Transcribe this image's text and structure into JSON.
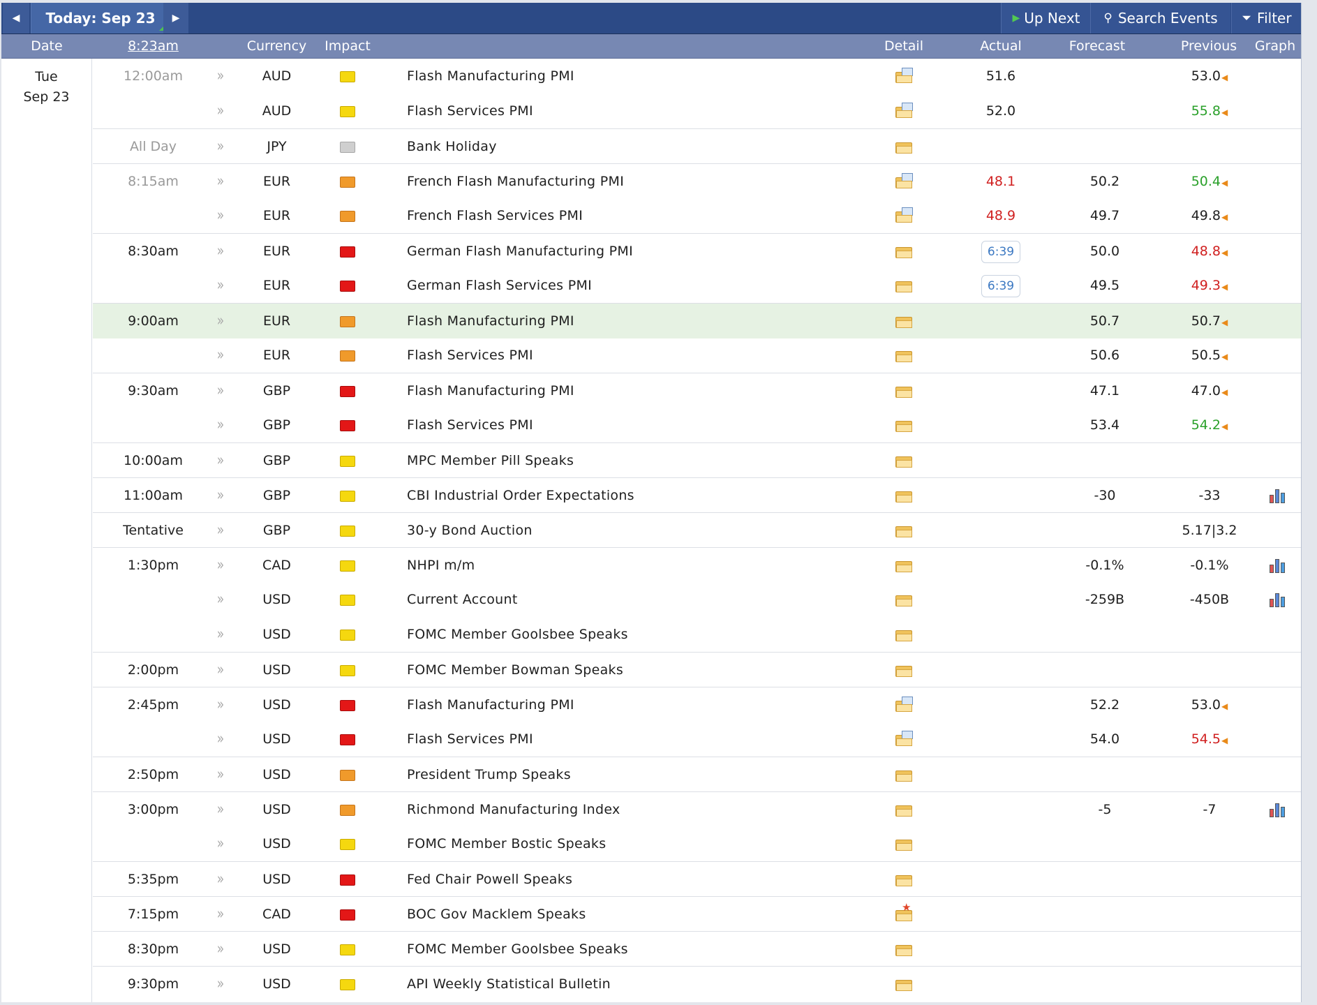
{
  "toolbar": {
    "prev_icon": "◀",
    "today_label": "Today: Sep 23",
    "next_icon": "▶",
    "up_next_label": "Up Next",
    "search_label": "Search Events",
    "filter_label": "Filter"
  },
  "headers": {
    "date": "Date",
    "time": "8:23am",
    "currency": "Currency",
    "impact": "Impact",
    "detail": "Detail",
    "actual": "Actual",
    "forecast": "Forecast",
    "previous": "Previous",
    "graph": "Graph"
  },
  "day": {
    "weekday": "Tue",
    "date": "Sep 23"
  },
  "colors": {
    "impact_high": "#e31717",
    "impact_medium": "#f09a2b",
    "impact_low": "#f5d80f",
    "impact_holiday": "#cfcfcf",
    "better": "#2aa02a",
    "worse": "#d02020"
  },
  "events": [
    {
      "time": "12:00am",
      "past": true,
      "currency": "AUD",
      "impact": "low",
      "event": "Flash Manufacturing PMI",
      "detail": "doc",
      "actual": "51.6",
      "actual_class": "",
      "forecast": "",
      "previous": "53.0",
      "previous_class": "",
      "revised": true,
      "graph": false
    },
    {
      "time": "",
      "past": true,
      "currency": "AUD",
      "impact": "low",
      "event": "Flash Services PMI",
      "detail": "doc",
      "actual": "52.0",
      "actual_class": "",
      "forecast": "",
      "previous": "55.8",
      "previous_class": "green",
      "revised": true,
      "graph": false
    },
    {
      "time": "All Day",
      "past": true,
      "currency": "JPY",
      "impact": "holiday",
      "event": "Bank Holiday",
      "detail": "plain",
      "actual": "",
      "actual_class": "",
      "forecast": "",
      "previous": "",
      "previous_class": "",
      "revised": false,
      "graph": false
    },
    {
      "time": "8:15am",
      "past": true,
      "currency": "EUR",
      "impact": "medium",
      "event": "French Flash Manufacturing PMI",
      "detail": "doc",
      "actual": "48.1",
      "actual_class": "red",
      "forecast": "50.2",
      "previous": "50.4",
      "previous_class": "green",
      "revised": true,
      "graph": false
    },
    {
      "time": "",
      "past": true,
      "currency": "EUR",
      "impact": "medium",
      "event": "French Flash Services PMI",
      "detail": "doc",
      "actual": "48.9",
      "actual_class": "red",
      "forecast": "49.7",
      "previous": "49.8",
      "previous_class": "",
      "revised": true,
      "graph": false
    },
    {
      "time": "8:30am",
      "past": false,
      "currency": "EUR",
      "impact": "high",
      "event": "German Flash Manufacturing PMI",
      "detail": "plain",
      "actual": "6:39",
      "actual_class": "countdown",
      "forecast": "50.0",
      "previous": "48.8",
      "previous_class": "red",
      "revised": true,
      "graph": false
    },
    {
      "time": "",
      "past": false,
      "currency": "EUR",
      "impact": "high",
      "event": "German Flash Services PMI",
      "detail": "plain",
      "actual": "6:39",
      "actual_class": "countdown",
      "forecast": "49.5",
      "previous": "49.3",
      "previous_class": "red",
      "revised": true,
      "graph": false
    },
    {
      "time": "9:00am",
      "past": false,
      "currency": "EUR",
      "impact": "medium",
      "event": "Flash Manufacturing PMI",
      "detail": "plain",
      "actual": "",
      "actual_class": "",
      "forecast": "50.7",
      "previous": "50.7",
      "previous_class": "",
      "revised": true,
      "graph": false,
      "highlight": true
    },
    {
      "time": "",
      "past": false,
      "currency": "EUR",
      "impact": "medium",
      "event": "Flash Services PMI",
      "detail": "plain",
      "actual": "",
      "actual_class": "",
      "forecast": "50.6",
      "previous": "50.5",
      "previous_class": "",
      "revised": true,
      "graph": false
    },
    {
      "time": "9:30am",
      "past": false,
      "currency": "GBP",
      "impact": "high",
      "event": "Flash Manufacturing PMI",
      "detail": "plain",
      "actual": "",
      "actual_class": "",
      "forecast": "47.1",
      "previous": "47.0",
      "previous_class": "",
      "revised": true,
      "graph": false
    },
    {
      "time": "",
      "past": false,
      "currency": "GBP",
      "impact": "high",
      "event": "Flash Services PMI",
      "detail": "plain",
      "actual": "",
      "actual_class": "",
      "forecast": "53.4",
      "previous": "54.2",
      "previous_class": "green",
      "revised": true,
      "graph": false
    },
    {
      "time": "10:00am",
      "past": false,
      "currency": "GBP",
      "impact": "low",
      "event": "MPC Member Pill Speaks",
      "detail": "plain",
      "actual": "",
      "actual_class": "",
      "forecast": "",
      "previous": "",
      "previous_class": "",
      "revised": false,
      "graph": false
    },
    {
      "time": "11:00am",
      "past": false,
      "currency": "GBP",
      "impact": "low",
      "event": "CBI Industrial Order Expectations",
      "detail": "plain",
      "actual": "",
      "actual_class": "",
      "forecast": "-30",
      "previous": "-33",
      "previous_class": "",
      "revised": false,
      "graph": true
    },
    {
      "time": "Tentative",
      "past": false,
      "currency": "GBP",
      "impact": "low",
      "event": "30-y Bond Auction",
      "detail": "plain",
      "actual": "",
      "actual_class": "",
      "forecast": "",
      "previous": "5.17|3.2",
      "previous_class": "",
      "revised": false,
      "graph": false
    },
    {
      "time": "1:30pm",
      "past": false,
      "currency": "CAD",
      "impact": "low",
      "event": "NHPI m/m",
      "detail": "plain",
      "actual": "",
      "actual_class": "",
      "forecast": "-0.1%",
      "previous": "-0.1%",
      "previous_class": "",
      "revised": false,
      "graph": true
    },
    {
      "time": "",
      "past": false,
      "currency": "USD",
      "impact": "low",
      "event": "Current Account",
      "detail": "plain",
      "actual": "",
      "actual_class": "",
      "forecast": "-259B",
      "previous": "-450B",
      "previous_class": "",
      "revised": false,
      "graph": true
    },
    {
      "time": "",
      "past": false,
      "currency": "USD",
      "impact": "low",
      "event": "FOMC Member Goolsbee Speaks",
      "detail": "plain",
      "actual": "",
      "actual_class": "",
      "forecast": "",
      "previous": "",
      "previous_class": "",
      "revised": false,
      "graph": false
    },
    {
      "time": "2:00pm",
      "past": false,
      "currency": "USD",
      "impact": "low",
      "event": "FOMC Member Bowman Speaks",
      "detail": "plain",
      "actual": "",
      "actual_class": "",
      "forecast": "",
      "previous": "",
      "previous_class": "",
      "revised": false,
      "graph": false
    },
    {
      "time": "2:45pm",
      "past": false,
      "currency": "USD",
      "impact": "high",
      "event": "Flash Manufacturing PMI",
      "detail": "doc",
      "actual": "",
      "actual_class": "",
      "forecast": "52.2",
      "previous": "53.0",
      "previous_class": "",
      "revised": true,
      "graph": false
    },
    {
      "time": "",
      "past": false,
      "currency": "USD",
      "impact": "high",
      "event": "Flash Services PMI",
      "detail": "doc",
      "actual": "",
      "actual_class": "",
      "forecast": "54.0",
      "previous": "54.5",
      "previous_class": "red",
      "revised": true,
      "graph": false
    },
    {
      "time": "2:50pm",
      "past": false,
      "currency": "USD",
      "impact": "medium",
      "event": "President Trump Speaks",
      "detail": "plain",
      "actual": "",
      "actual_class": "",
      "forecast": "",
      "previous": "",
      "previous_class": "",
      "revised": false,
      "graph": false
    },
    {
      "time": "3:00pm",
      "past": false,
      "currency": "USD",
      "impact": "medium",
      "event": "Richmond Manufacturing Index",
      "detail": "plain",
      "actual": "",
      "actual_class": "",
      "forecast": "-5",
      "previous": "-7",
      "previous_class": "",
      "revised": false,
      "graph": true
    },
    {
      "time": "",
      "past": false,
      "currency": "USD",
      "impact": "low",
      "event": "FOMC Member Bostic Speaks",
      "detail": "plain",
      "actual": "",
      "actual_class": "",
      "forecast": "",
      "previous": "",
      "previous_class": "",
      "revised": false,
      "graph": false
    },
    {
      "time": "5:35pm",
      "past": false,
      "currency": "USD",
      "impact": "high",
      "event": "Fed Chair Powell Speaks",
      "detail": "plain",
      "actual": "",
      "actual_class": "",
      "forecast": "",
      "previous": "",
      "previous_class": "",
      "revised": false,
      "graph": false
    },
    {
      "time": "7:15pm",
      "past": false,
      "currency": "CAD",
      "impact": "high",
      "event": "BOC Gov Macklem Speaks",
      "detail": "star",
      "actual": "",
      "actual_class": "",
      "forecast": "",
      "previous": "",
      "previous_class": "",
      "revised": false,
      "graph": false
    },
    {
      "time": "8:30pm",
      "past": false,
      "currency": "USD",
      "impact": "low",
      "event": "FOMC Member Goolsbee Speaks",
      "detail": "plain",
      "actual": "",
      "actual_class": "",
      "forecast": "",
      "previous": "",
      "previous_class": "",
      "revised": false,
      "graph": false
    },
    {
      "time": "9:30pm",
      "past": false,
      "currency": "USD",
      "impact": "low",
      "event": "API Weekly Statistical Bulletin",
      "detail": "plain",
      "actual": "",
      "actual_class": "",
      "forecast": "",
      "previous": "",
      "previous_class": "",
      "revised": false,
      "graph": false
    }
  ]
}
